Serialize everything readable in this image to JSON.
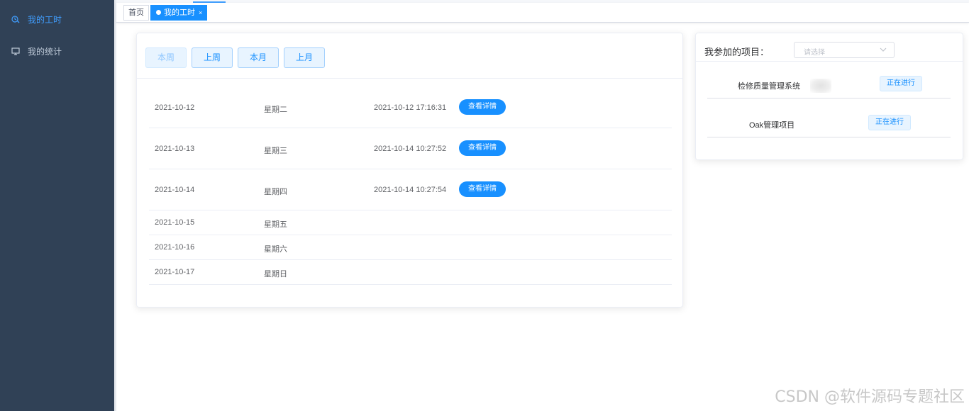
{
  "sidebar": {
    "items": [
      {
        "label": "我的工时",
        "icon": "clock-tools-icon",
        "active": true
      },
      {
        "label": "我的统计",
        "icon": "monitor-icon",
        "active": false
      }
    ]
  },
  "tags": {
    "home": "首页",
    "active": "我的工时",
    "close_glyph": "×"
  },
  "filters": {
    "this_week": "本周",
    "last_week": "上周",
    "this_month": "本月",
    "last_month": "上月"
  },
  "timesheet": {
    "rows": [
      {
        "date": "2021-10-12",
        "weekday": "星期二",
        "submitted": "2021-10-12 17:16:31",
        "action": "查看详情"
      },
      {
        "date": "2021-10-13",
        "weekday": "星期三",
        "submitted": "2021-10-14 10:27:52",
        "action": "查看详情"
      },
      {
        "date": "2021-10-14",
        "weekday": "星期四",
        "submitted": "2021-10-14 10:27:54",
        "action": "查看详情"
      },
      {
        "date": "2021-10-15",
        "weekday": "星期五",
        "submitted": "",
        "action": ""
      },
      {
        "date": "2021-10-16",
        "weekday": "星期六",
        "submitted": "",
        "action": ""
      },
      {
        "date": "2021-10-17",
        "weekday": "星期日",
        "submitted": "",
        "action": ""
      }
    ]
  },
  "projects": {
    "title": "我参加的项目：",
    "select_placeholder": "请选择",
    "items": [
      {
        "name": "检修质量管理系统",
        "status": "正在进行"
      },
      {
        "name": "Oak管理项目",
        "status": "正在进行"
      }
    ]
  },
  "watermark": "CSDN @软件源码专题社区",
  "colors": {
    "sidebar_bg": "#304156",
    "accent": "#1890ff",
    "active_menu": "#409eff"
  }
}
